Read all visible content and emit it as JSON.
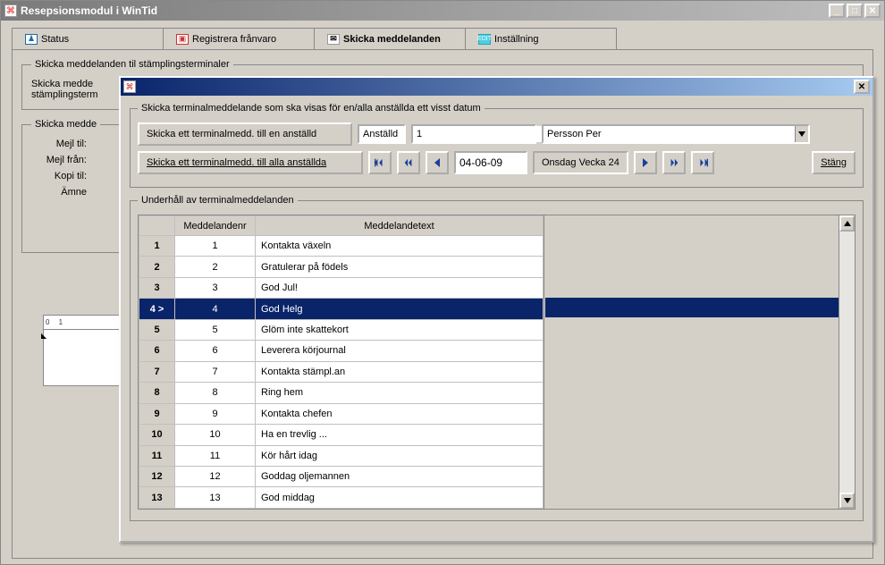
{
  "window": {
    "title": "Resepsionsmodul i WinTid"
  },
  "tabs": {
    "status": "Status",
    "registrera": "Registrera frånvaro",
    "skicka": "Skicka meddelanden",
    "installning": "Inställning"
  },
  "bgGroup1": {
    "legend": "Skicka meddelanden til stämplingsterminaler",
    "partial": "Skicka medde\nstämplingsterm"
  },
  "bgGroup2": {
    "legend": "Skicka medde",
    "mejlTil": "Mejl til:",
    "mejlFran": "Mejl från:",
    "kopiTil": "Kopi til:",
    "amne": "Ämne"
  },
  "ruler": {
    "marks": "0   1",
    "tri": "◣"
  },
  "dialog": {
    "group1": {
      "legend": "Skicka terminalmeddelande som ska visas för en/alla anställda ett visst datum",
      "btnOne": "Skicka ett terminalmedd. till en anställd",
      "anstalldLabel": "Anställd",
      "anstalldValue": "1",
      "personValue": "Persson Per",
      "btnAll": "Skicka ett terminalmedd. till alla anställda",
      "dateValue": "04-06-09",
      "dateLabel": "Onsdag Vecka 24",
      "closeLabel": "Stäng"
    },
    "group2": {
      "legend": "Underhåll av terminalmeddelanden",
      "colA": "Meddelandenr",
      "colB": "Meddelandetext",
      "rows": [
        {
          "n": "1",
          "nr": "1",
          "txt": "Kontakta växeln"
        },
        {
          "n": "2",
          "nr": "2",
          "txt": "Gratulerar på födels"
        },
        {
          "n": "3",
          "nr": "3",
          "txt": "God Jul!"
        },
        {
          "n": "4 >",
          "nr": "4",
          "txt": "God Helg"
        },
        {
          "n": "5",
          "nr": "5",
          "txt": "Glöm inte skattekort"
        },
        {
          "n": "6",
          "nr": "6",
          "txt": "Leverera körjournal"
        },
        {
          "n": "7",
          "nr": "7",
          "txt": "Kontakta stämpl.an"
        },
        {
          "n": "8",
          "nr": "8",
          "txt": "Ring hem"
        },
        {
          "n": "9",
          "nr": "9",
          "txt": "Kontakta chefen"
        },
        {
          "n": "10",
          "nr": "10",
          "txt": "Ha en trevlig ..."
        },
        {
          "n": "11",
          "nr": "11",
          "txt": "Kör hårt idag"
        },
        {
          "n": "12",
          "nr": "12",
          "txt": "Goddag oljemannen"
        },
        {
          "n": "13",
          "nr": "13",
          "txt": "God middag"
        }
      ]
    }
  }
}
